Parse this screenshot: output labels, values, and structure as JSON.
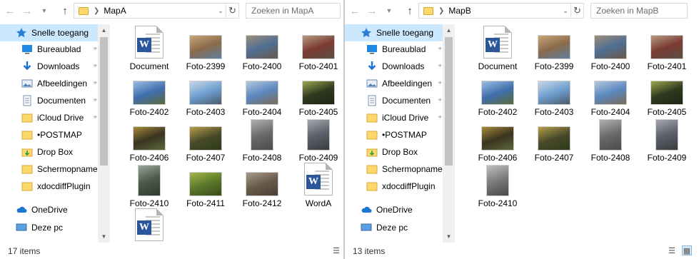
{
  "windows": [
    {
      "folder": "MapA",
      "search_placeholder": "Zoeken in MapA",
      "status": "17 items",
      "nav": [
        {
          "label": "Snelle toegang",
          "icon": "star-icon",
          "selected": true,
          "pinned": false
        },
        {
          "label": "Bureaublad",
          "icon": "desktop-icon",
          "selected": false,
          "pinned": true
        },
        {
          "label": "Downloads",
          "icon": "download-icon",
          "selected": false,
          "pinned": true
        },
        {
          "label": "Afbeeldingen",
          "icon": "pictures-icon",
          "selected": false,
          "pinned": true
        },
        {
          "label": "Documenten",
          "icon": "documents-icon",
          "selected": false,
          "pinned": true
        },
        {
          "label": "iCloud Drive",
          "icon": "folder-icon",
          "selected": false,
          "pinned": true
        },
        {
          "label": "•POSTMAP",
          "icon": "folder-icon",
          "selected": false,
          "pinned": false
        },
        {
          "label": "Drop Box",
          "icon": "dropbox-folder-icon",
          "selected": false,
          "pinned": false
        },
        {
          "label": "Schermopnamen",
          "icon": "folder-icon",
          "selected": false,
          "pinned": false
        },
        {
          "label": "xdocdiffPlugin",
          "icon": "folder-icon",
          "selected": false,
          "pinned": false
        },
        {
          "label": "OneDrive",
          "icon": "onedrive-icon",
          "selected": false,
          "pinned": false
        },
        {
          "label": "Deze pc",
          "icon": "pc-icon",
          "selected": false,
          "pinned": false
        }
      ],
      "files": [
        {
          "name": "Document",
          "kind": "word"
        },
        {
          "name": "Foto-2399",
          "kind": "photo",
          "colors": [
            "#8a6a4a",
            "#c9a77a",
            "#5f7fa0"
          ]
        },
        {
          "name": "Foto-2400",
          "kind": "photo",
          "colors": [
            "#4f6e93",
            "#9c8e7a",
            "#6d5a4a"
          ]
        },
        {
          "name": "Foto-2401",
          "kind": "photo",
          "colors": [
            "#7a3a32",
            "#b79b84",
            "#5b4f44"
          ]
        },
        {
          "name": "Foto-2402",
          "kind": "photo",
          "colors": [
            "#3f6fae",
            "#9cbde0",
            "#5b6b3a"
          ]
        },
        {
          "name": "Foto-2403",
          "kind": "photo",
          "colors": [
            "#6f9fd0",
            "#c8d8e8",
            "#4a5a6a"
          ]
        },
        {
          "name": "Foto-2404",
          "kind": "photo",
          "colors": [
            "#5b88c0",
            "#b5c9dd",
            "#7a6a55"
          ]
        },
        {
          "name": "Foto-2405",
          "kind": "photo",
          "colors": [
            "#2f3a1f",
            "#9aa650",
            "#1f2414"
          ]
        },
        {
          "name": "Foto-2406",
          "kind": "photo",
          "colors": [
            "#3a3320",
            "#a68a3a",
            "#5a6a3a"
          ]
        },
        {
          "name": "Foto-2407",
          "kind": "photo",
          "colors": [
            "#4a4a2a",
            "#b5a04a",
            "#2a3a1a"
          ]
        },
        {
          "name": "Foto-2408",
          "kind": "photo-tall",
          "colors": [
            "#6a6a6a",
            "#b0b0b0",
            "#4a4a4a"
          ]
        },
        {
          "name": "Foto-2409",
          "kind": "photo-tall",
          "colors": [
            "#5a5f6a",
            "#a5a8ad",
            "#3a3d40"
          ]
        },
        {
          "name": "Foto-2410",
          "kind": "photo-tall",
          "colors": [
            "#4a5a4a",
            "#9aa59a",
            "#2f3a2f"
          ]
        },
        {
          "name": "Foto-2411",
          "kind": "photo",
          "colors": [
            "#5a7a2a",
            "#a5b54a",
            "#3a4a1a"
          ]
        },
        {
          "name": "Foto-2412",
          "kind": "photo",
          "colors": [
            "#6a5a4a",
            "#a89a88",
            "#4a3f35"
          ]
        },
        {
          "name": "WordA",
          "kind": "word"
        },
        {
          "name": "",
          "kind": "word"
        }
      ]
    },
    {
      "folder": "MapB",
      "search_placeholder": "Zoeken in MapB",
      "status": "13 items",
      "nav": [
        {
          "label": "Snelle toegang",
          "icon": "star-icon",
          "selected": true,
          "pinned": false
        },
        {
          "label": "Bureaublad",
          "icon": "desktop-icon",
          "selected": false,
          "pinned": true
        },
        {
          "label": "Downloads",
          "icon": "download-icon",
          "selected": false,
          "pinned": true
        },
        {
          "label": "Afbeeldingen",
          "icon": "pictures-icon",
          "selected": false,
          "pinned": true
        },
        {
          "label": "Documenten",
          "icon": "documents-icon",
          "selected": false,
          "pinned": true
        },
        {
          "label": "iCloud Drive",
          "icon": "folder-icon",
          "selected": false,
          "pinned": true
        },
        {
          "label": "•POSTMAP",
          "icon": "folder-icon",
          "selected": false,
          "pinned": false
        },
        {
          "label": "Drop Box",
          "icon": "dropbox-folder-icon",
          "selected": false,
          "pinned": false
        },
        {
          "label": "Schermopnamen",
          "icon": "folder-icon",
          "selected": false,
          "pinned": false
        },
        {
          "label": "xdocdiffPlugin",
          "icon": "folder-icon",
          "selected": false,
          "pinned": false
        },
        {
          "label": "OneDrive",
          "icon": "onedrive-icon",
          "selected": false,
          "pinned": false
        },
        {
          "label": "Deze pc",
          "icon": "pc-icon",
          "selected": false,
          "pinned": false
        }
      ],
      "files": [
        {
          "name": "Document",
          "kind": "word"
        },
        {
          "name": "Foto-2399",
          "kind": "photo",
          "colors": [
            "#8a6a4a",
            "#c9a77a",
            "#5f7fa0"
          ]
        },
        {
          "name": "Foto-2400",
          "kind": "photo",
          "colors": [
            "#4f6e93",
            "#9c8e7a",
            "#6d5a4a"
          ]
        },
        {
          "name": "Foto-2401",
          "kind": "photo",
          "colors": [
            "#7a3a32",
            "#b79b84",
            "#5b4f44"
          ]
        },
        {
          "name": "Foto-2402",
          "kind": "photo",
          "colors": [
            "#3f6fae",
            "#9cbde0",
            "#5b6b3a"
          ]
        },
        {
          "name": "Foto-2403",
          "kind": "photo",
          "colors": [
            "#6f9fd0",
            "#c8d8e8",
            "#4a5a6a"
          ]
        },
        {
          "name": "Foto-2404",
          "kind": "photo",
          "colors": [
            "#5b88c0",
            "#b5c9dd",
            "#7a6a55"
          ]
        },
        {
          "name": "Foto-2405",
          "kind": "photo",
          "colors": [
            "#2f3a1f",
            "#9aa650",
            "#1f2414"
          ]
        },
        {
          "name": "Foto-2406",
          "kind": "photo",
          "colors": [
            "#3a3320",
            "#a68a3a",
            "#5a6a3a"
          ]
        },
        {
          "name": "Foto-2407",
          "kind": "photo",
          "colors": [
            "#4a4a2a",
            "#b5a04a",
            "#2a3a1a"
          ]
        },
        {
          "name": "Foto-2408",
          "kind": "photo-tall",
          "colors": [
            "#6a6a6a",
            "#b0b0b0",
            "#4a4a4a"
          ]
        },
        {
          "name": "Foto-2409",
          "kind": "photo-tall",
          "colors": [
            "#5a5f6a",
            "#a5a8ad",
            "#3a3d40"
          ]
        },
        {
          "name": "Foto-2410",
          "kind": "photo-tall",
          "colors": [
            "#7a7a7a",
            "#c0c0c0",
            "#4a4a4a"
          ]
        }
      ]
    }
  ],
  "colors": {
    "selection": "#cce8ff",
    "word_blue": "#2b579a",
    "folder_yellow": "#ffd76a"
  }
}
